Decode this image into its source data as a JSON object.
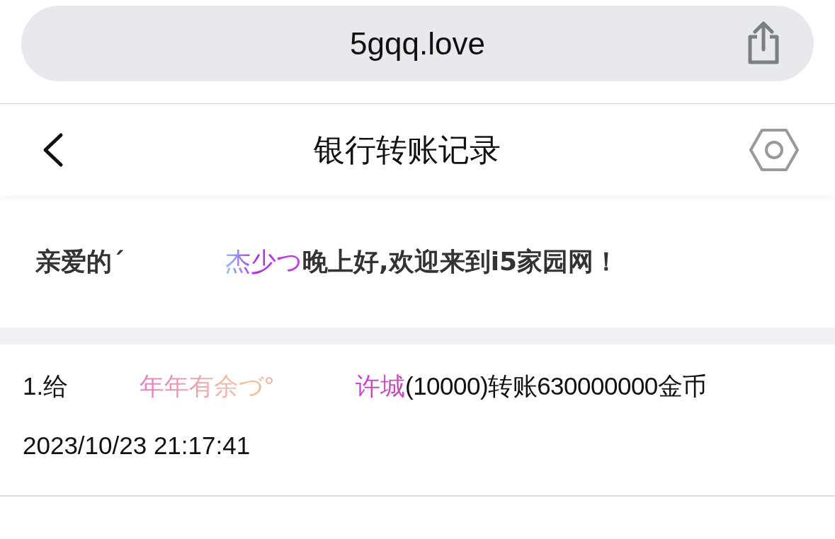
{
  "browser": {
    "address": "5gqq.love"
  },
  "header": {
    "title": "银行转账记录"
  },
  "greeting": {
    "salutation": "亲爱的ˊ",
    "name": "杰少つ",
    "message": "晚上好,欢迎来到i5家园网！"
  },
  "transfers": [
    {
      "prefix": "1.给",
      "sender": "年年有余づ°",
      "recipient": "许城",
      "detail": "(10000)转账630000000金币",
      "time": "2023/10/23 21:17:41"
    }
  ]
}
